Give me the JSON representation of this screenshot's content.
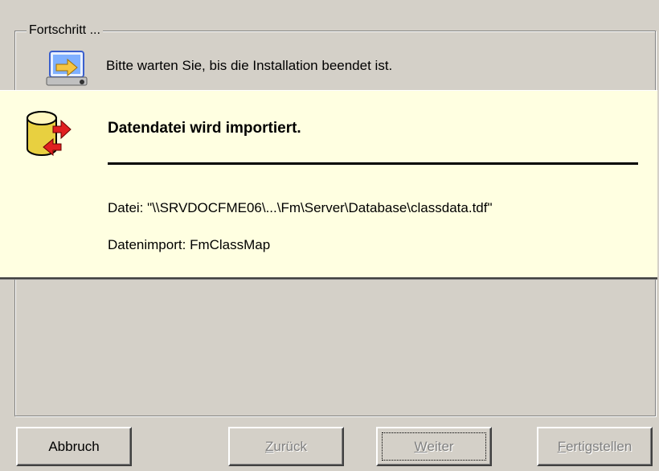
{
  "group": {
    "label": "Fortschritt ...",
    "status_text": "Bitte warten Sie, bis die Installation beendet ist.",
    "icon": "installer-icon"
  },
  "task": {
    "icon": "database-import-icon",
    "title": "Datendatei wird importiert.",
    "file_label": "Datei:",
    "file_path": "\"\\\\SRVDOCFME06\\...\\Fm\\Server\\Database\\classdata.tdf\"",
    "import_label": "Datenimport:",
    "import_value": "FmClassMap",
    "panel_color": "#ffffe1"
  },
  "buttons": {
    "cancel": "Abbruch",
    "back_mnemonic": "Z",
    "back_rest": "urück",
    "next_mnemonic": "W",
    "next_rest": "eiter",
    "finish_mnemonic": "F",
    "finish_rest": "ertigstellen"
  }
}
